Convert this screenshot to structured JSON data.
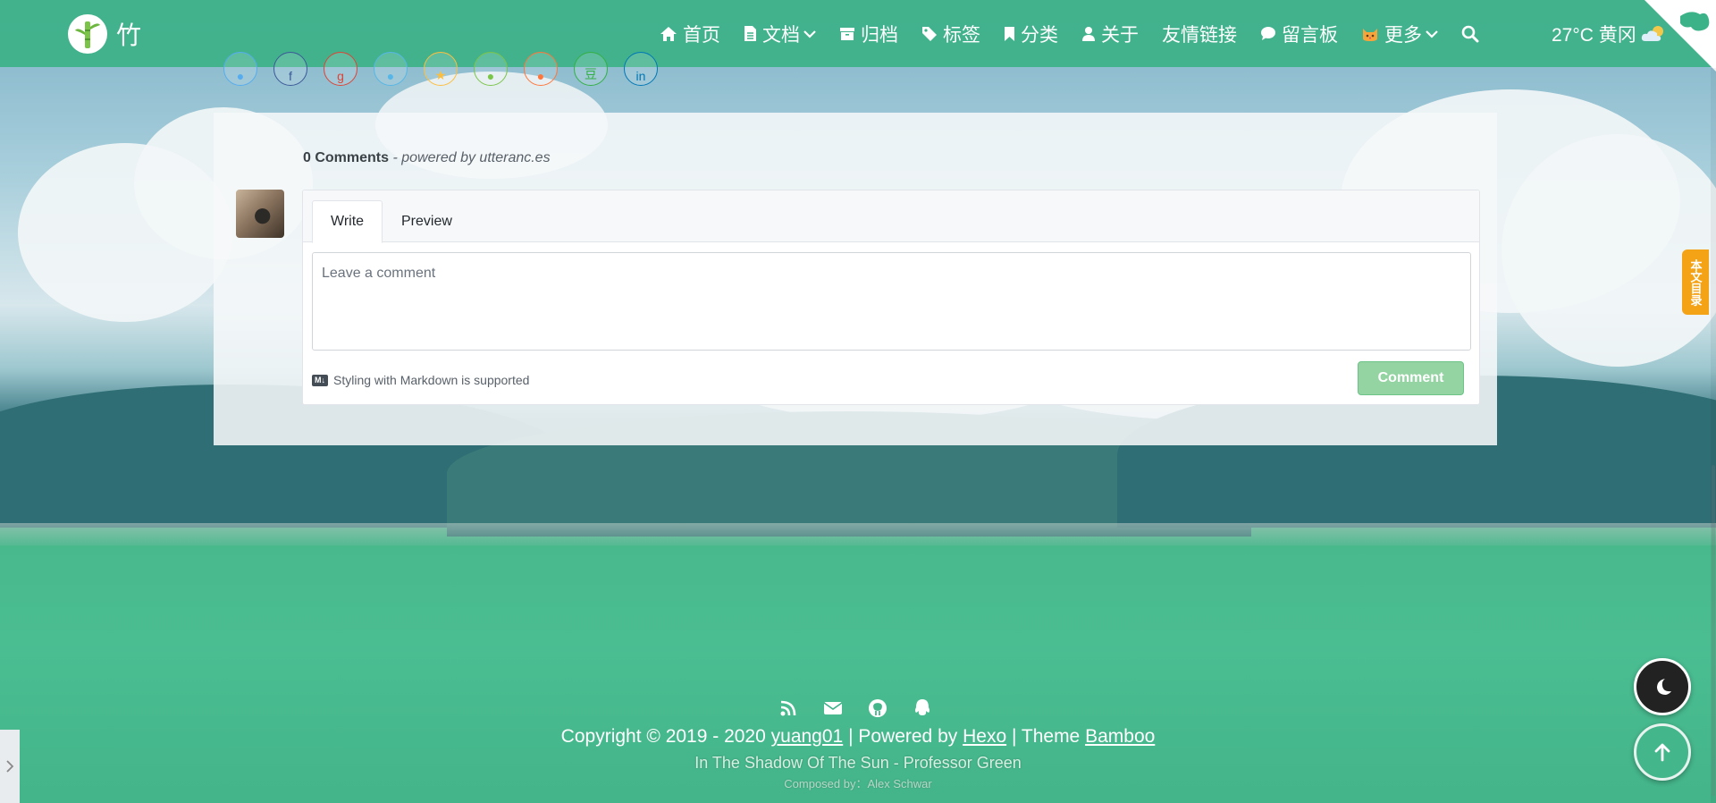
{
  "brand": {
    "logo_icon": "bamboo-logo-icon",
    "name": "竹"
  },
  "nav": {
    "items": [
      {
        "label": "首页",
        "icon": "home-icon",
        "dropdown": false
      },
      {
        "label": "文档",
        "icon": "document-icon",
        "dropdown": true
      },
      {
        "label": "归档",
        "icon": "archive-icon",
        "dropdown": false
      },
      {
        "label": "标签",
        "icon": "tag-icon",
        "dropdown": false
      },
      {
        "label": "分类",
        "icon": "bookmark-icon",
        "dropdown": false
      },
      {
        "label": "关于",
        "icon": "user-icon",
        "dropdown": false
      },
      {
        "label": "友情链接",
        "icon": "",
        "dropdown": false
      },
      {
        "label": "留言板",
        "icon": "comment-icon",
        "dropdown": false
      },
      {
        "label": "更多",
        "icon": "cat-icon",
        "dropdown": true
      }
    ],
    "search_icon": "search-icon"
  },
  "weather": {
    "text": "27°C 黄冈",
    "icon": "cloud-icon"
  },
  "social_share": [
    "twitter",
    "facebook",
    "google-plus",
    "qq",
    "qzone",
    "wechat",
    "weibo",
    "douban",
    "linkedin"
  ],
  "comments": {
    "count_label": "0 Comments",
    "powered_by": "- powered by utteranc.es",
    "tabs": {
      "write": "Write",
      "preview": "Preview"
    },
    "textarea_placeholder": "Leave a comment",
    "markdown_badge": "M↓",
    "markdown_note": "Styling with Markdown is supported",
    "submit_label": "Comment"
  },
  "toc_tab": "本文目录",
  "footer": {
    "copyright_prefix": "Copyright © 2019 - 2020",
    "author": "yuang01",
    "powered_prefix": "| Powered by",
    "engine": "Hexo",
    "theme_prefix": "| Theme",
    "theme": "Bamboo",
    "song": "In The Shadow Of The Sun - Professor Green",
    "composer": "Composed by：Alex Schwar",
    "icons": [
      "rss-icon",
      "email-icon",
      "github-icon",
      "qq-icon"
    ]
  },
  "colors": {
    "primary": "#3cb288",
    "comment_button": "#94d3a2",
    "toc_tab": "#f5a316",
    "dark_mode_button": "#222222"
  }
}
